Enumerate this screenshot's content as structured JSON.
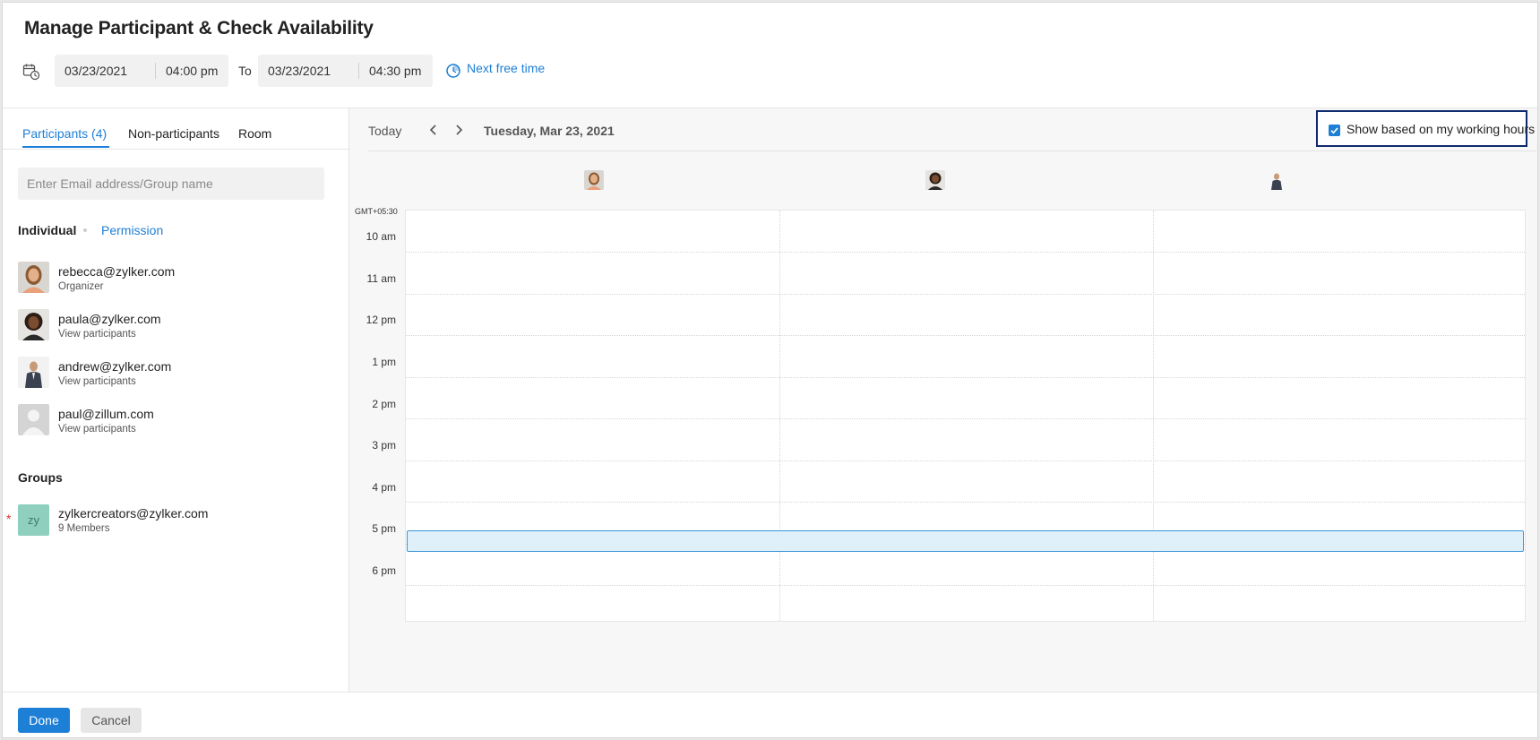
{
  "title": "Manage Participant & Check Availability",
  "time_range": {
    "start_date": "03/23/2021",
    "start_time": "04:00 pm",
    "to_label": "To",
    "end_date": "03/23/2021",
    "end_time": "04:30 pm",
    "next_free_label": "Next free time"
  },
  "tabs": [
    {
      "label": "Participants (4)",
      "active": true
    },
    {
      "label": "Non-participants",
      "active": false
    },
    {
      "label": "Room",
      "active": false
    }
  ],
  "search": {
    "placeholder": "Enter Email address/Group name"
  },
  "individual": {
    "label": "Individual",
    "permission_label": "Permission",
    "people": [
      {
        "email": "rebecca@zylker.com",
        "sub": "Organizer"
      },
      {
        "email": "paula@zylker.com",
        "sub": "View participants"
      },
      {
        "email": "andrew@zylker.com",
        "sub": "View participants"
      },
      {
        "email": "paul@zillum.com",
        "sub": "View participants",
        "required_mark": "*"
      }
    ]
  },
  "groups": {
    "label": "Groups",
    "items": [
      {
        "initials": "zy",
        "email": "zylkercreators@zylker.com",
        "members": "9 Members"
      }
    ]
  },
  "calendar": {
    "today_label": "Today",
    "date_label": "Tuesday, Mar 23, 2021",
    "working_hours_label": "Show based on my working hours",
    "working_hours_checked": true,
    "timezone": "GMT+05:30",
    "hours": [
      "10 am",
      "11 am",
      "12 pm",
      "1 pm",
      "2 pm",
      "3 pm",
      "4 pm",
      "5 pm",
      "6 pm"
    ]
  },
  "footer": {
    "done_label": "Done",
    "cancel_label": "Cancel"
  },
  "colors": {
    "accent": "#1e7fd6",
    "highlight_border": "#0e2a6e",
    "event_fill": "#dff0fb"
  }
}
